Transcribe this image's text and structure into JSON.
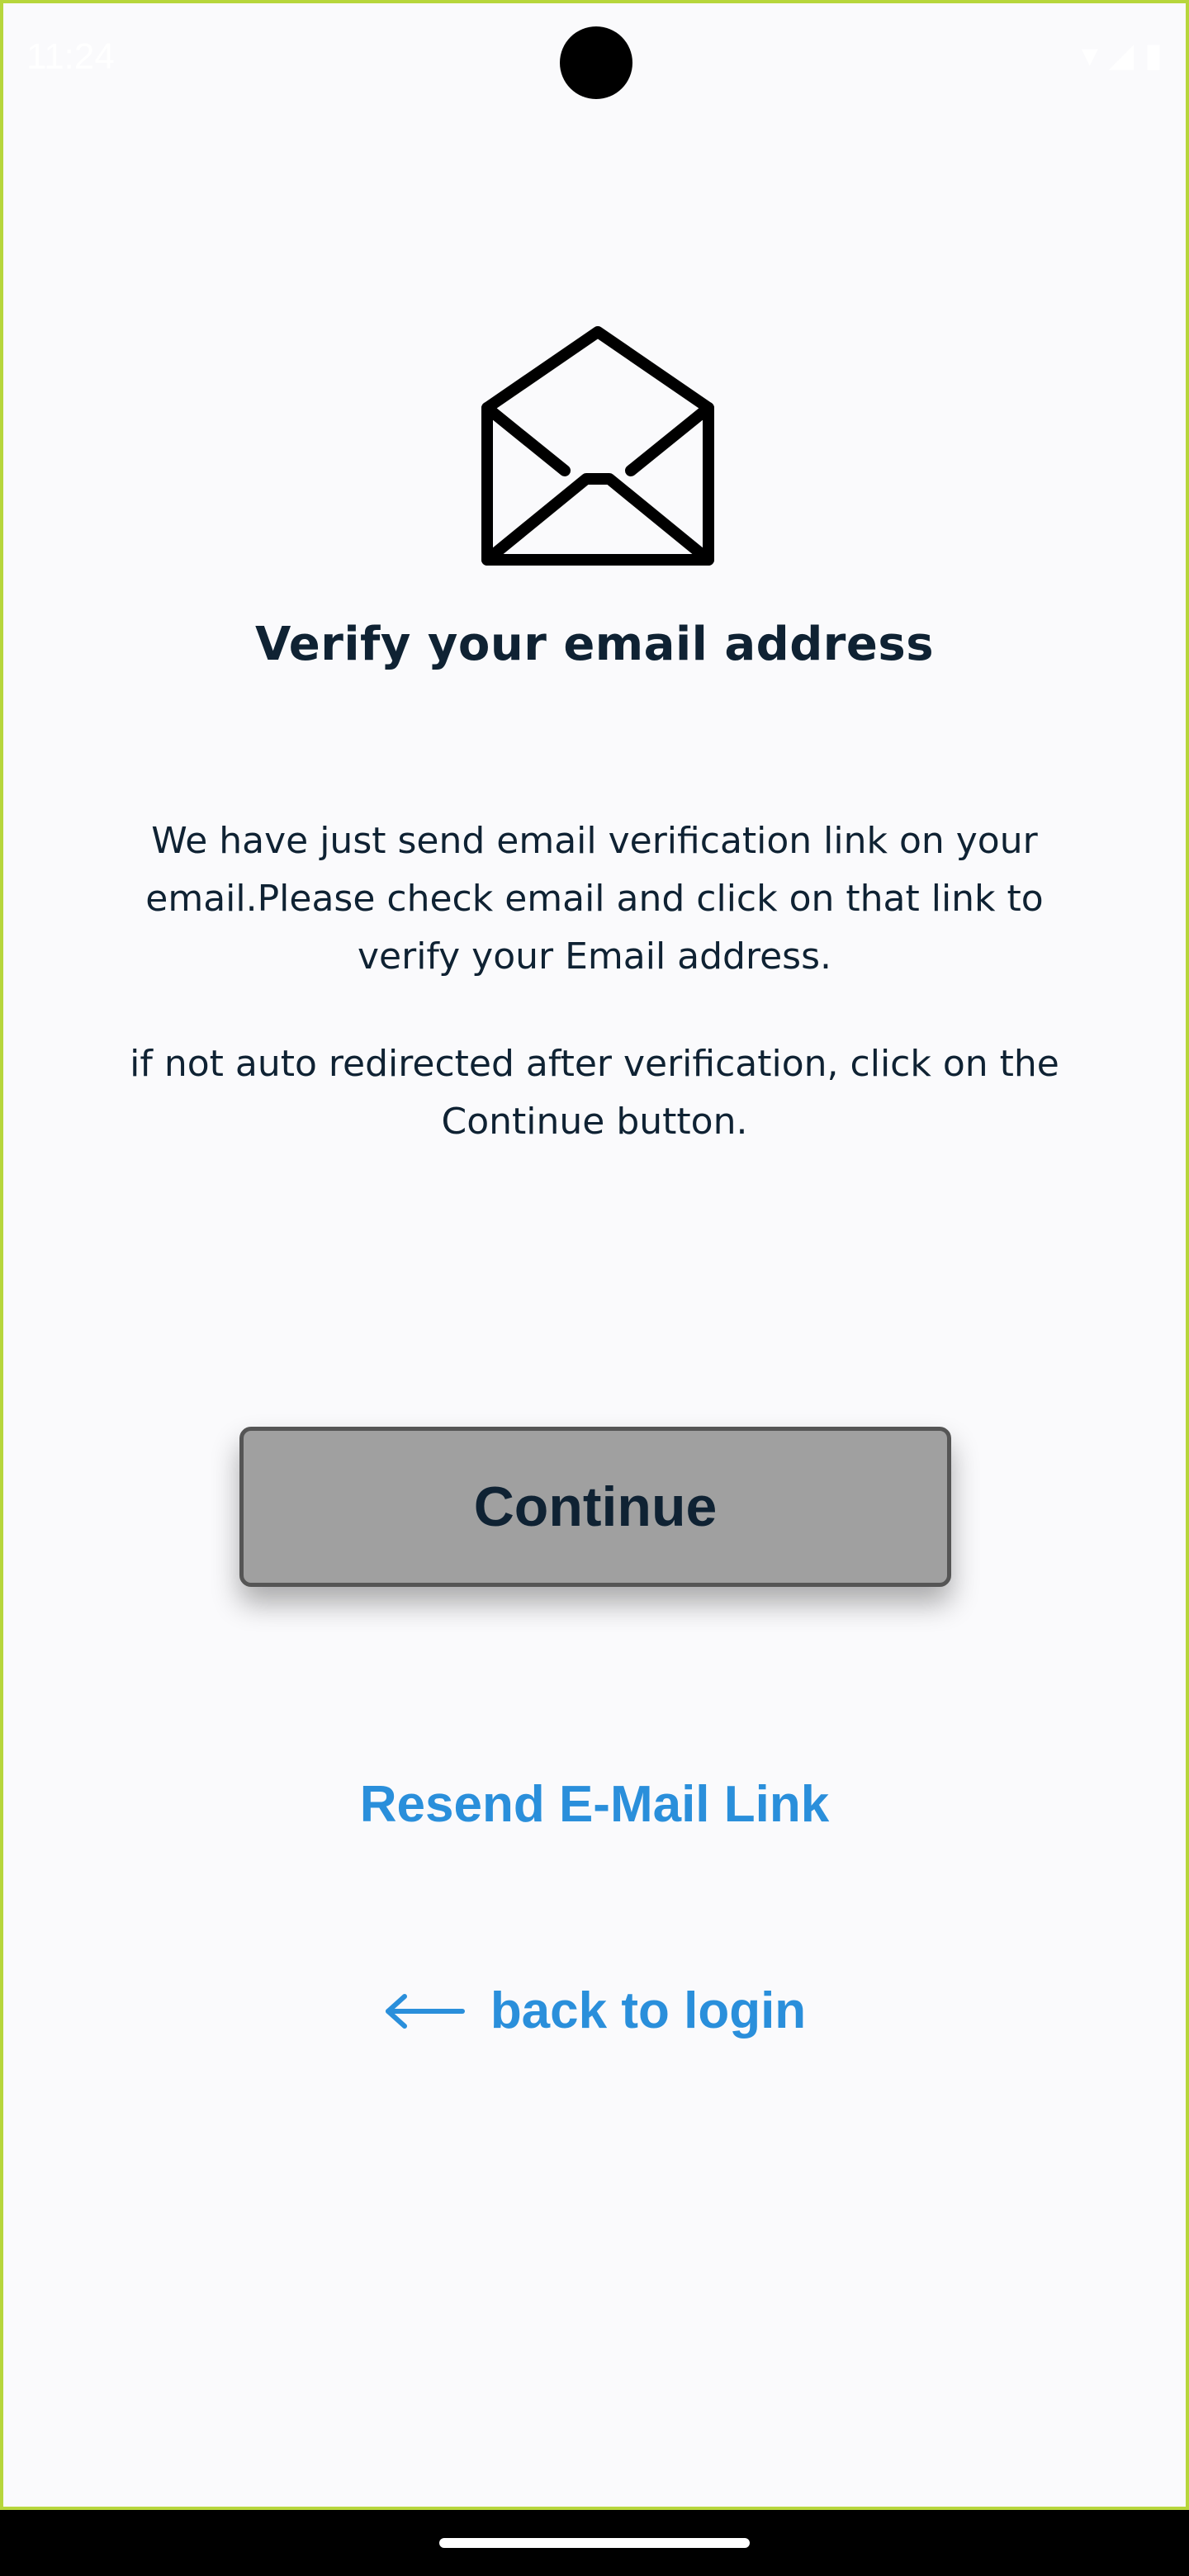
{
  "status_bar": {
    "time": "11:24",
    "icons": [
      "wifi-icon",
      "signal-icon",
      "battery-icon"
    ]
  },
  "envelope_icon": "open-envelope-icon",
  "title": "Verify your email address",
  "message": "We have just send email verification link on your email.Please check email and click on that link to verify your Email address.",
  "hint": "if not auto redirected after verification, click on the Continue button.",
  "buttons": {
    "continue": "Continue"
  },
  "links": {
    "resend": "Resend E-Mail Link",
    "back_to_login": "back to login"
  },
  "colors": {
    "background": "#fafafc",
    "text": "#0f2233",
    "link": "#2a8fdb",
    "button_fill": "#a0a0a0",
    "button_border": "#555555"
  }
}
